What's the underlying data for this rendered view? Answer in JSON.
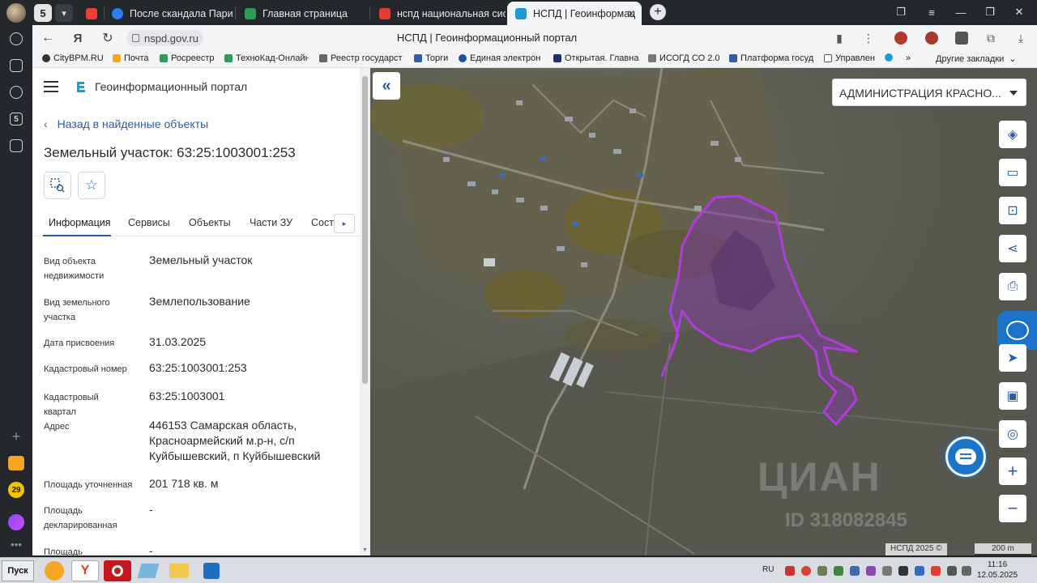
{
  "browser": {
    "tab_counter": "5",
    "tabs": [
      {
        "title": "",
        "color": "#ea4335"
      },
      {
        "title": "После скандала Париж п",
        "color": "#2d7cf0"
      },
      {
        "title": "Главная страница",
        "color": "#2e9b59"
      },
      {
        "title": "нспд национальная систе",
        "color": "#e33b2e"
      },
      {
        "title": "НСПД | Геоинформац",
        "color": "#1d9bd6"
      }
    ],
    "url": "nspd.gov.ru",
    "page_title": "НСПД | Геоинформационный портал",
    "bookmarks": [
      "CityBPM.RU",
      "Почта",
      "Росреестр",
      "ТехноКад-Онлайн",
      "Реестр государст",
      "Торги",
      "Единая электрон",
      "Открытая. Главна",
      "ИСОГД СО 2.0",
      "Платформа госуд",
      "Управлен"
    ],
    "bookmarks_more": "»",
    "other_bookmarks": "Другие закладки",
    "sidebar_badge": "29"
  },
  "panel": {
    "portal_name": "Геоинформационный портал",
    "back_link": "Назад в найденные объекты",
    "object_title": "Земельный участок: 63:25:1003001:253",
    "tabs": [
      "Информация",
      "Сервисы",
      "Объекты",
      "Части ЗУ",
      "Состав"
    ],
    "rows": [
      {
        "label": "Вид объекта недвижимости",
        "value": "Земельный участок"
      },
      {
        "label": "Вид земельного участка",
        "value": "Землепользование"
      },
      {
        "label": "Дата присвоения",
        "value": "31.03.2025"
      },
      {
        "label": "Кадастровый номер",
        "value": "63:25:1003001:253"
      },
      {
        "label": "Кадастровый квартал",
        "value": "63:25:1003001"
      },
      {
        "label": "Адрес",
        "value": "446153 Самарская область, Красноармейский м.р-н, с/п Куйбышевский, п Куйбышевский"
      },
      {
        "label": "Площадь уточненная",
        "value": "201 718 кв. м"
      },
      {
        "label": "Площадь декларированная",
        "value": "-"
      },
      {
        "label": "Площадь",
        "value": "-"
      }
    ]
  },
  "map": {
    "org_select": "АДМИНИСТРАЦИЯ КРАСНО...",
    "watermark": "ЦИАН",
    "watermark_id": "ID 318082845",
    "attribution": "НСПД 2025 ©",
    "scale": "200 m",
    "parcel_color": "#b03cdc",
    "tools": [
      "layers-icon",
      "ruler-icon",
      "search-area-icon",
      "share-icon",
      "print-icon",
      "navigate-icon",
      "inset-map-icon",
      "locate-icon",
      "zoom-in-icon",
      "zoom-out-icon"
    ]
  },
  "taskbar": {
    "start": "Пуск",
    "lang": "RU",
    "time": "11:16",
    "date": "12.05.2025"
  }
}
